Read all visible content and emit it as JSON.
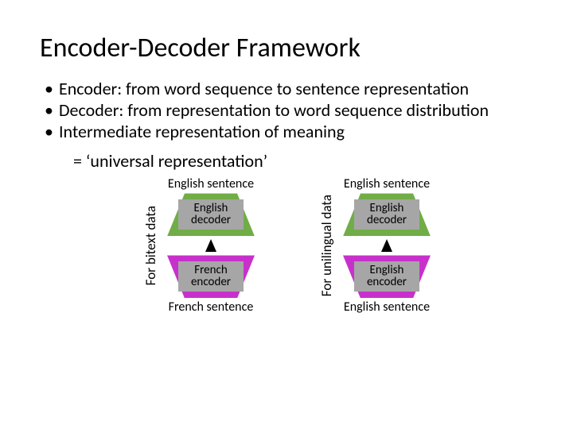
{
  "title": "Encoder-Decoder Framework",
  "bullets": {
    "b1": "Encoder: from word sequence to sentence representation",
    "b2": "Decoder: from representation to word sequence distribution",
    "b3": "Intermediate representation of meaning"
  },
  "sub": "= ‘universal representation’",
  "left": {
    "side_label": "For bitext data",
    "top_caption": "English sentence",
    "decoder_label": "English\ndecoder",
    "encoder_label": "French\nencoder",
    "bottom_caption": "French sentence"
  },
  "right": {
    "side_label": "For unilingual data",
    "top_caption": "English sentence",
    "decoder_label": "English\ndecoder",
    "encoder_label": "English\nencoder",
    "bottom_caption": "English sentence"
  }
}
